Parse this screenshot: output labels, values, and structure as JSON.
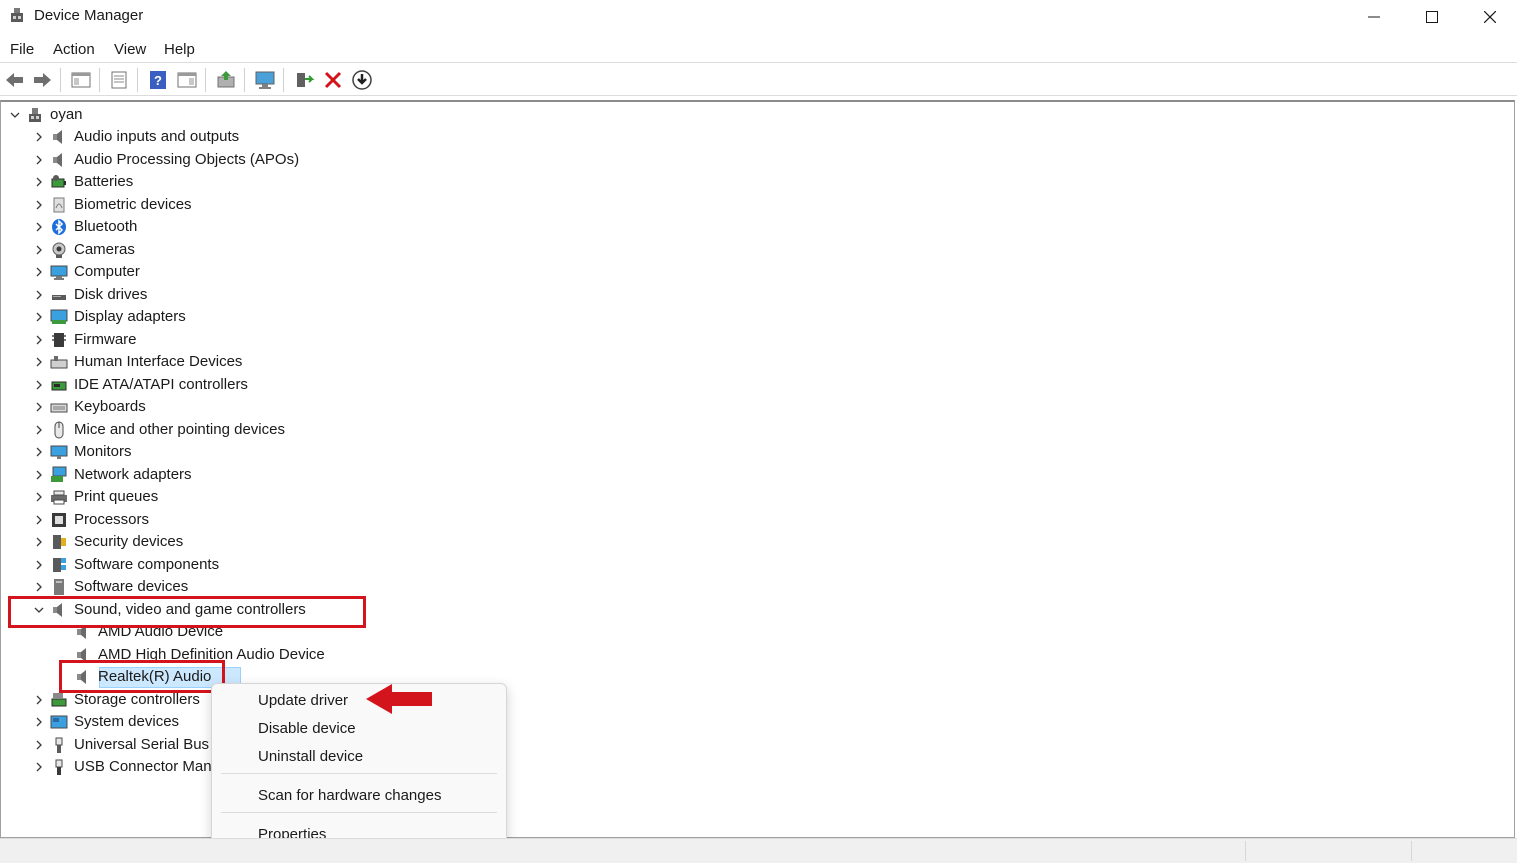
{
  "window": {
    "title": "Device Manager"
  },
  "menu": [
    "File",
    "Action",
    "View",
    "Help"
  ],
  "toolbar_icons": [
    "back-icon",
    "forward-icon",
    "show-hide-console-tree-icon",
    "properties-icon",
    "help-icon",
    "action-pane-icon",
    "update-driver-icon",
    "scan-hardware-icon",
    "enable-device-icon",
    "uninstall-device-icon",
    "download-driver-icon"
  ],
  "tree": {
    "root": "oyan",
    "categories": [
      {
        "label": "Audio inputs and outputs",
        "icon": "speaker-icon"
      },
      {
        "label": "Audio Processing Objects (APOs)",
        "icon": "speaker-icon"
      },
      {
        "label": "Batteries",
        "icon": "battery-icon"
      },
      {
        "label": "Biometric devices",
        "icon": "fingerprint-icon"
      },
      {
        "label": "Bluetooth",
        "icon": "bluetooth-icon"
      },
      {
        "label": "Cameras",
        "icon": "camera-icon"
      },
      {
        "label": "Computer",
        "icon": "computer-icon"
      },
      {
        "label": "Disk drives",
        "icon": "disk-drive-icon"
      },
      {
        "label": "Display adapters",
        "icon": "display-adapter-icon"
      },
      {
        "label": "Firmware",
        "icon": "firmware-icon"
      },
      {
        "label": "Human Interface Devices",
        "icon": "hid-icon"
      },
      {
        "label": "IDE ATA/ATAPI controllers",
        "icon": "ide-controller-icon"
      },
      {
        "label": "Keyboards",
        "icon": "keyboard-icon"
      },
      {
        "label": "Mice and other pointing devices",
        "icon": "mouse-icon"
      },
      {
        "label": "Monitors",
        "icon": "monitor-icon"
      },
      {
        "label": "Network adapters",
        "icon": "network-adapter-icon"
      },
      {
        "label": "Print queues",
        "icon": "printer-icon"
      },
      {
        "label": "Processors",
        "icon": "processor-icon"
      },
      {
        "label": "Security devices",
        "icon": "security-device-icon"
      },
      {
        "label": "Software components",
        "icon": "software-component-icon"
      },
      {
        "label": "Software devices",
        "icon": "software-device-icon"
      }
    ],
    "expanded_category": {
      "label": "Sound, video and game controllers",
      "icon": "speaker-icon",
      "children": [
        "AMD Audio Device",
        "AMD High Definition Audio Device",
        "Realtek(R) Audio"
      ]
    },
    "after_categories": [
      {
        "label": "Storage controllers",
        "icon": "storage-controller-icon"
      },
      {
        "label": "System devices",
        "icon": "system-device-icon"
      },
      {
        "label": "Universal Serial Bus c",
        "icon": "usb-icon"
      },
      {
        "label": "USB Connector Man",
        "icon": "usb-connector-icon"
      }
    ]
  },
  "context_menu": {
    "update": "Update driver",
    "disable": "Disable device",
    "uninstall": "Uninstall device",
    "scan": "Scan for hardware changes",
    "properties": "Properties"
  },
  "colors": {
    "highlight": "#d4141c",
    "selection": "#cce8ff"
  }
}
